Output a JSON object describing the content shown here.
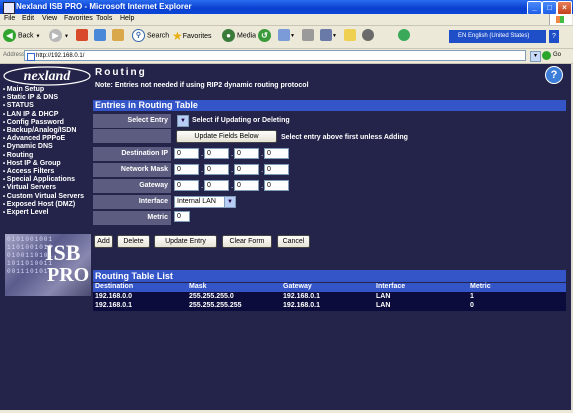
{
  "window": {
    "title": "Nexland ISB PRO - Microsoft Internet Explorer"
  },
  "menu": [
    "File",
    "Edit",
    "View",
    "Favorites",
    "Tools",
    "Help"
  ],
  "toolbar": {
    "back": "Back",
    "search": "Search",
    "favorites": "Favorites",
    "media": "Media",
    "language": "EN English (United States)",
    "help_q": "?"
  },
  "address": {
    "label": "Address",
    "url": "http://192.168.0.1/",
    "go": "Go"
  },
  "logo": "nexland",
  "nav": [
    "Main Setup",
    "Static IP & DNS",
    "STATUS",
    "LAN IP & DHCP",
    "Config Password",
    "Backup/Analog/ISDN",
    "Advanced PPPoE",
    "Dynamic DNS",
    "Routing",
    "Host IP & Group",
    "Access Filters",
    "Special Applications",
    "Virtual Servers",
    "Custom Virtual Servers",
    "Exposed Host (DMZ)",
    "Expert Level"
  ],
  "product_badge": {
    "line1": "ISB",
    "line2": "PRO",
    "bits": "0101001001\n1101001010\n0100110101\n1011010011\n0011101010"
  },
  "page": {
    "title": "Routing",
    "help": "?",
    "note": "Note: Entries not needed if using RIP2 dynamic routing protocol",
    "entries_title": "Entries in Routing Table",
    "select_entry_label": "Select Entry",
    "select_hint": "Select if Updating or Deleting",
    "update_fields_btn": "Update Fields Below",
    "update_hint": "Select entry above first unless Adding",
    "dest_label": "Destination IP",
    "mask_label": "Network Mask",
    "gateway_label": "Gateway",
    "interface_label": "Interface",
    "metric_label": "Metric",
    "dest_ip": [
      "0",
      "0",
      "0",
      "0"
    ],
    "mask": [
      "0",
      "0",
      "0",
      "0"
    ],
    "gateway": [
      "0",
      "0",
      "0",
      "0"
    ],
    "interface_value": "Internal LAN",
    "metric_value": "0",
    "buttons": {
      "add": "Add",
      "delete": "Delete",
      "update": "Update Entry",
      "clear": "Clear Form",
      "cancel": "Cancel"
    }
  },
  "routing_table": {
    "title": "Routing Table List",
    "headers": [
      "Destination",
      "Mask",
      "Gateway",
      "Interface",
      "Metric"
    ],
    "rows": [
      [
        "192.168.0.0",
        "255.255.255.0",
        "192.168.0.1",
        "LAN",
        "1"
      ],
      [
        "192.168.0.1",
        "255.255.255.255",
        "192.168.0.1",
        "LAN",
        "0"
      ]
    ]
  },
  "colors": {
    "page_bg": "#24244a",
    "section_bar": "#3355c8",
    "label_cell": "#5c5c80"
  }
}
